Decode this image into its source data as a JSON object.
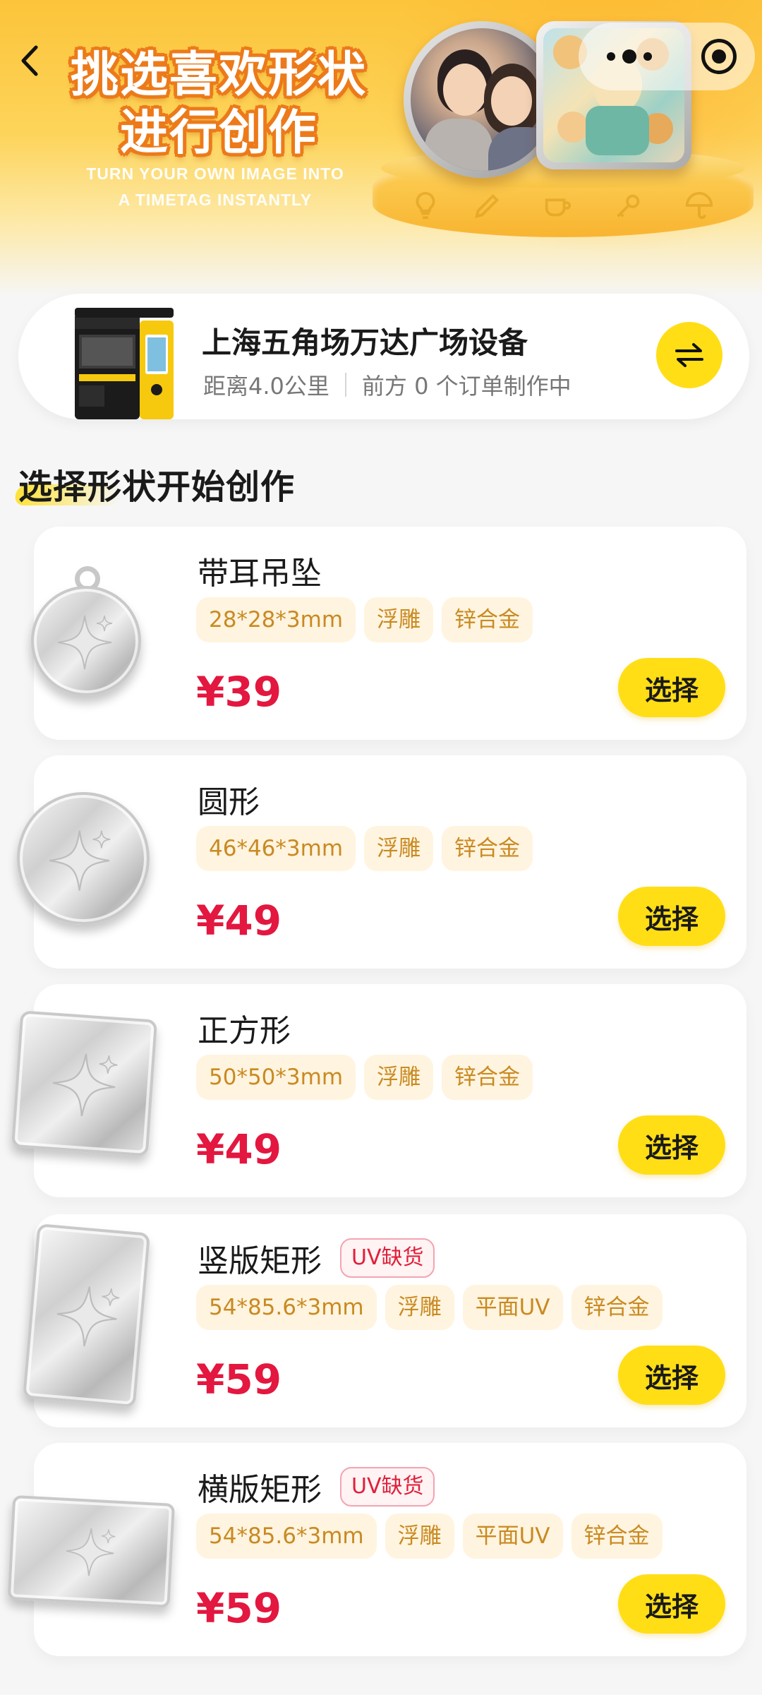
{
  "header": {
    "back_icon": "chevron-left-icon",
    "title": "挑选喜欢形状\n进行创作",
    "subtitle": "TURN YOUR OWN IMAGE INTO\nA TIMETAG INSTANTLY",
    "menu_icon": "more-dots-icon",
    "close_icon": "target-icon"
  },
  "device": {
    "name": "上海五角场万达广场设备",
    "distance": "距离4.0公里",
    "queue": "前方 0 个订单制作中",
    "switch_icon": "swap-arrows-icon"
  },
  "section_title": "选择形状开始创作",
  "products": [
    {
      "name": "带耳吊坠",
      "oos": "",
      "tags": [
        "28*28*3mm",
        "浮雕",
        "锌合金"
      ],
      "price": "¥39",
      "button": "选择"
    },
    {
      "name": "圆形",
      "oos": "",
      "tags": [
        "46*46*3mm",
        "浮雕",
        "锌合金"
      ],
      "price": "¥49",
      "button": "选择"
    },
    {
      "name": "正方形",
      "oos": "",
      "tags": [
        "50*50*3mm",
        "浮雕",
        "锌合金"
      ],
      "price": "¥49",
      "button": "选择"
    },
    {
      "name": "竖版矩形",
      "oos": "UV缺货",
      "tags": [
        "54*85.6*3mm",
        "浮雕",
        "平面UV",
        "锌合金"
      ],
      "price": "¥59",
      "button": "选择"
    },
    {
      "name": "横版矩形",
      "oos": "UV缺货",
      "tags": [
        "54*85.6*3mm",
        "浮雕",
        "平面UV",
        "锌合金"
      ],
      "price": "¥59",
      "button": "选择"
    }
  ],
  "colors": {
    "accent_yellow": "#ffde16",
    "price_red": "#e3173f",
    "tag_bg": "#fff4df",
    "tag_text": "#c98a22"
  }
}
